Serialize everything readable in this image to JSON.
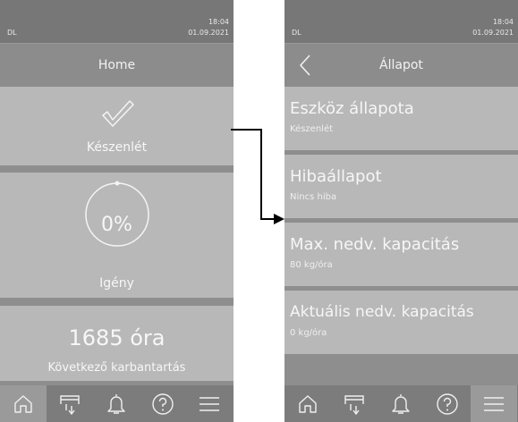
{
  "screens": [
    {
      "statusbar": {
        "user": "DL",
        "time": "18:04",
        "date": "01.09.2021"
      },
      "title": "Home",
      "status_card": {
        "label": "Készenlét",
        "icon": "checkmark-icon"
      },
      "demand_card": {
        "value": "0%",
        "label": "Igény"
      },
      "maintenance_card": {
        "value": "1685 óra",
        "label": "Következő karbantartás"
      }
    },
    {
      "statusbar": {
        "user": "DL",
        "time": "18:04",
        "date": "01.09.2021"
      },
      "title": "Állapot",
      "items": [
        {
          "title": "Eszköz állapota",
          "subtitle": "Készenlét"
        },
        {
          "title": "Hibaállapot",
          "subtitle": "Nincs hiba"
        },
        {
          "title": "Max. nedv. kapacitás",
          "subtitle": "80 kg/óra"
        },
        {
          "title": "Aktuális nedv. kapacitás",
          "subtitle": "0 kg/óra"
        }
      ]
    }
  ],
  "navbar": [
    {
      "name": "home-icon"
    },
    {
      "name": "unit-icon"
    },
    {
      "name": "bell-icon"
    },
    {
      "name": "help-icon"
    },
    {
      "name": "menu-icon"
    }
  ],
  "colors": {
    "statusbar": "#777777",
    "panel": "#8e8e8e",
    "card": "#b8b8b8",
    "navbar": "#7c7c7c",
    "nav_active": "#9a9a9a"
  }
}
